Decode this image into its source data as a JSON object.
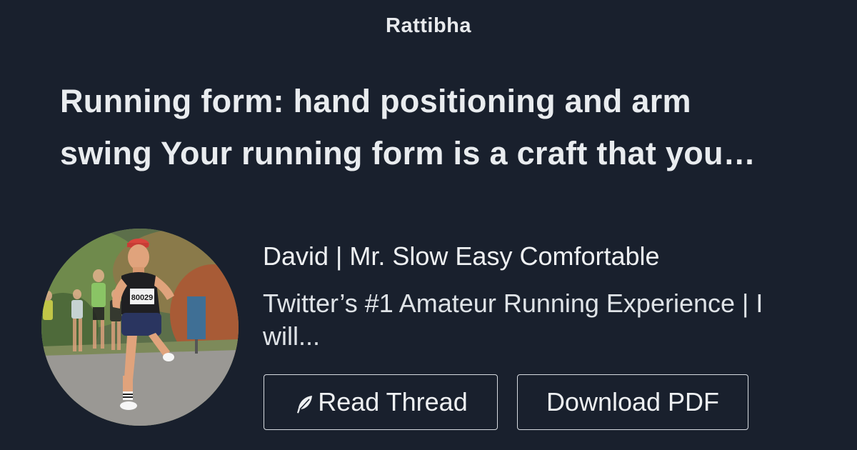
{
  "brand": {
    "name": "Rattibha"
  },
  "thread": {
    "title": "Running form: hand positioning and arm\nswing Your running form is a craft that you…"
  },
  "author": {
    "name": "David | Mr. Slow Easy Comfortable",
    "bio": "Twitter’s #1 Amateur Running Experience | I\nwill...",
    "avatar_bib_number": "80029"
  },
  "actions": {
    "read_thread_label": "Read Thread",
    "read_thread_icon": "feather-icon",
    "download_pdf_label": "Download PDF"
  },
  "colors": {
    "background": "#19202d",
    "text": "#e9ecef",
    "button_border": "#d7dbe0"
  }
}
